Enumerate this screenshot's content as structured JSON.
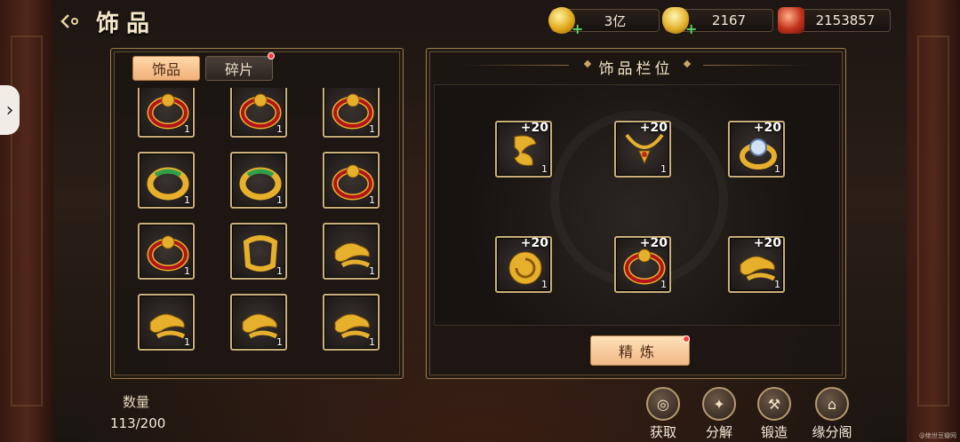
{
  "header": {
    "title": "饰品"
  },
  "currencies": [
    {
      "icon": "gold-coin-icon",
      "value": "3亿"
    },
    {
      "icon": "gold-ingot-icon",
      "value": "2167"
    },
    {
      "icon": "red-jade-icon",
      "value": "2153857"
    }
  ],
  "left_panel": {
    "tabs": [
      {
        "label": "饰品",
        "active": true
      },
      {
        "label": "碎片",
        "active": false,
        "has_dot": true
      }
    ],
    "items": [
      {
        "type": "red-bracelet",
        "qty": "1"
      },
      {
        "type": "red-bracelet",
        "qty": "1"
      },
      {
        "type": "red-bracelet",
        "qty": "1"
      },
      {
        "type": "gold-green-bracelet",
        "qty": "1"
      },
      {
        "type": "gold-green-bracelet",
        "qty": "1"
      },
      {
        "type": "red-bracelet",
        "qty": "1"
      },
      {
        "type": "red-bracelet",
        "qty": "1"
      },
      {
        "type": "gold-ring",
        "qty": "1"
      },
      {
        "type": "gold-dragon",
        "qty": "1"
      },
      {
        "type": "gold-dragon",
        "qty": "1"
      },
      {
        "type": "gold-dragon",
        "qty": "1"
      },
      {
        "type": "gold-dragon",
        "qty": "1"
      }
    ],
    "count_label": "数量",
    "count_value": "113/200"
  },
  "right_panel": {
    "title": "饰品栏位",
    "slots": [
      {
        "type": "gold-dragon-pendant",
        "level": "+20",
        "qty": "1"
      },
      {
        "type": "gold-necklace",
        "level": "+20",
        "qty": "1"
      },
      {
        "type": "gem-ring",
        "level": "+20",
        "qty": "1"
      },
      {
        "type": "gold-swirl",
        "level": "+20",
        "qty": "1"
      },
      {
        "type": "red-bracelet",
        "level": "+20",
        "qty": "1"
      },
      {
        "type": "gold-dragon",
        "level": "+20",
        "qty": "1"
      }
    ],
    "refine_label": "精炼"
  },
  "actions": [
    {
      "label": "获取",
      "icon": "obtain-icon"
    },
    {
      "label": "分解",
      "icon": "decompose-icon"
    },
    {
      "label": "锻造",
      "icon": "forge-hammer-icon"
    },
    {
      "label": "缘分阁",
      "icon": "pavilion-icon"
    }
  ],
  "watermark": "@绝世豆瓣网"
}
